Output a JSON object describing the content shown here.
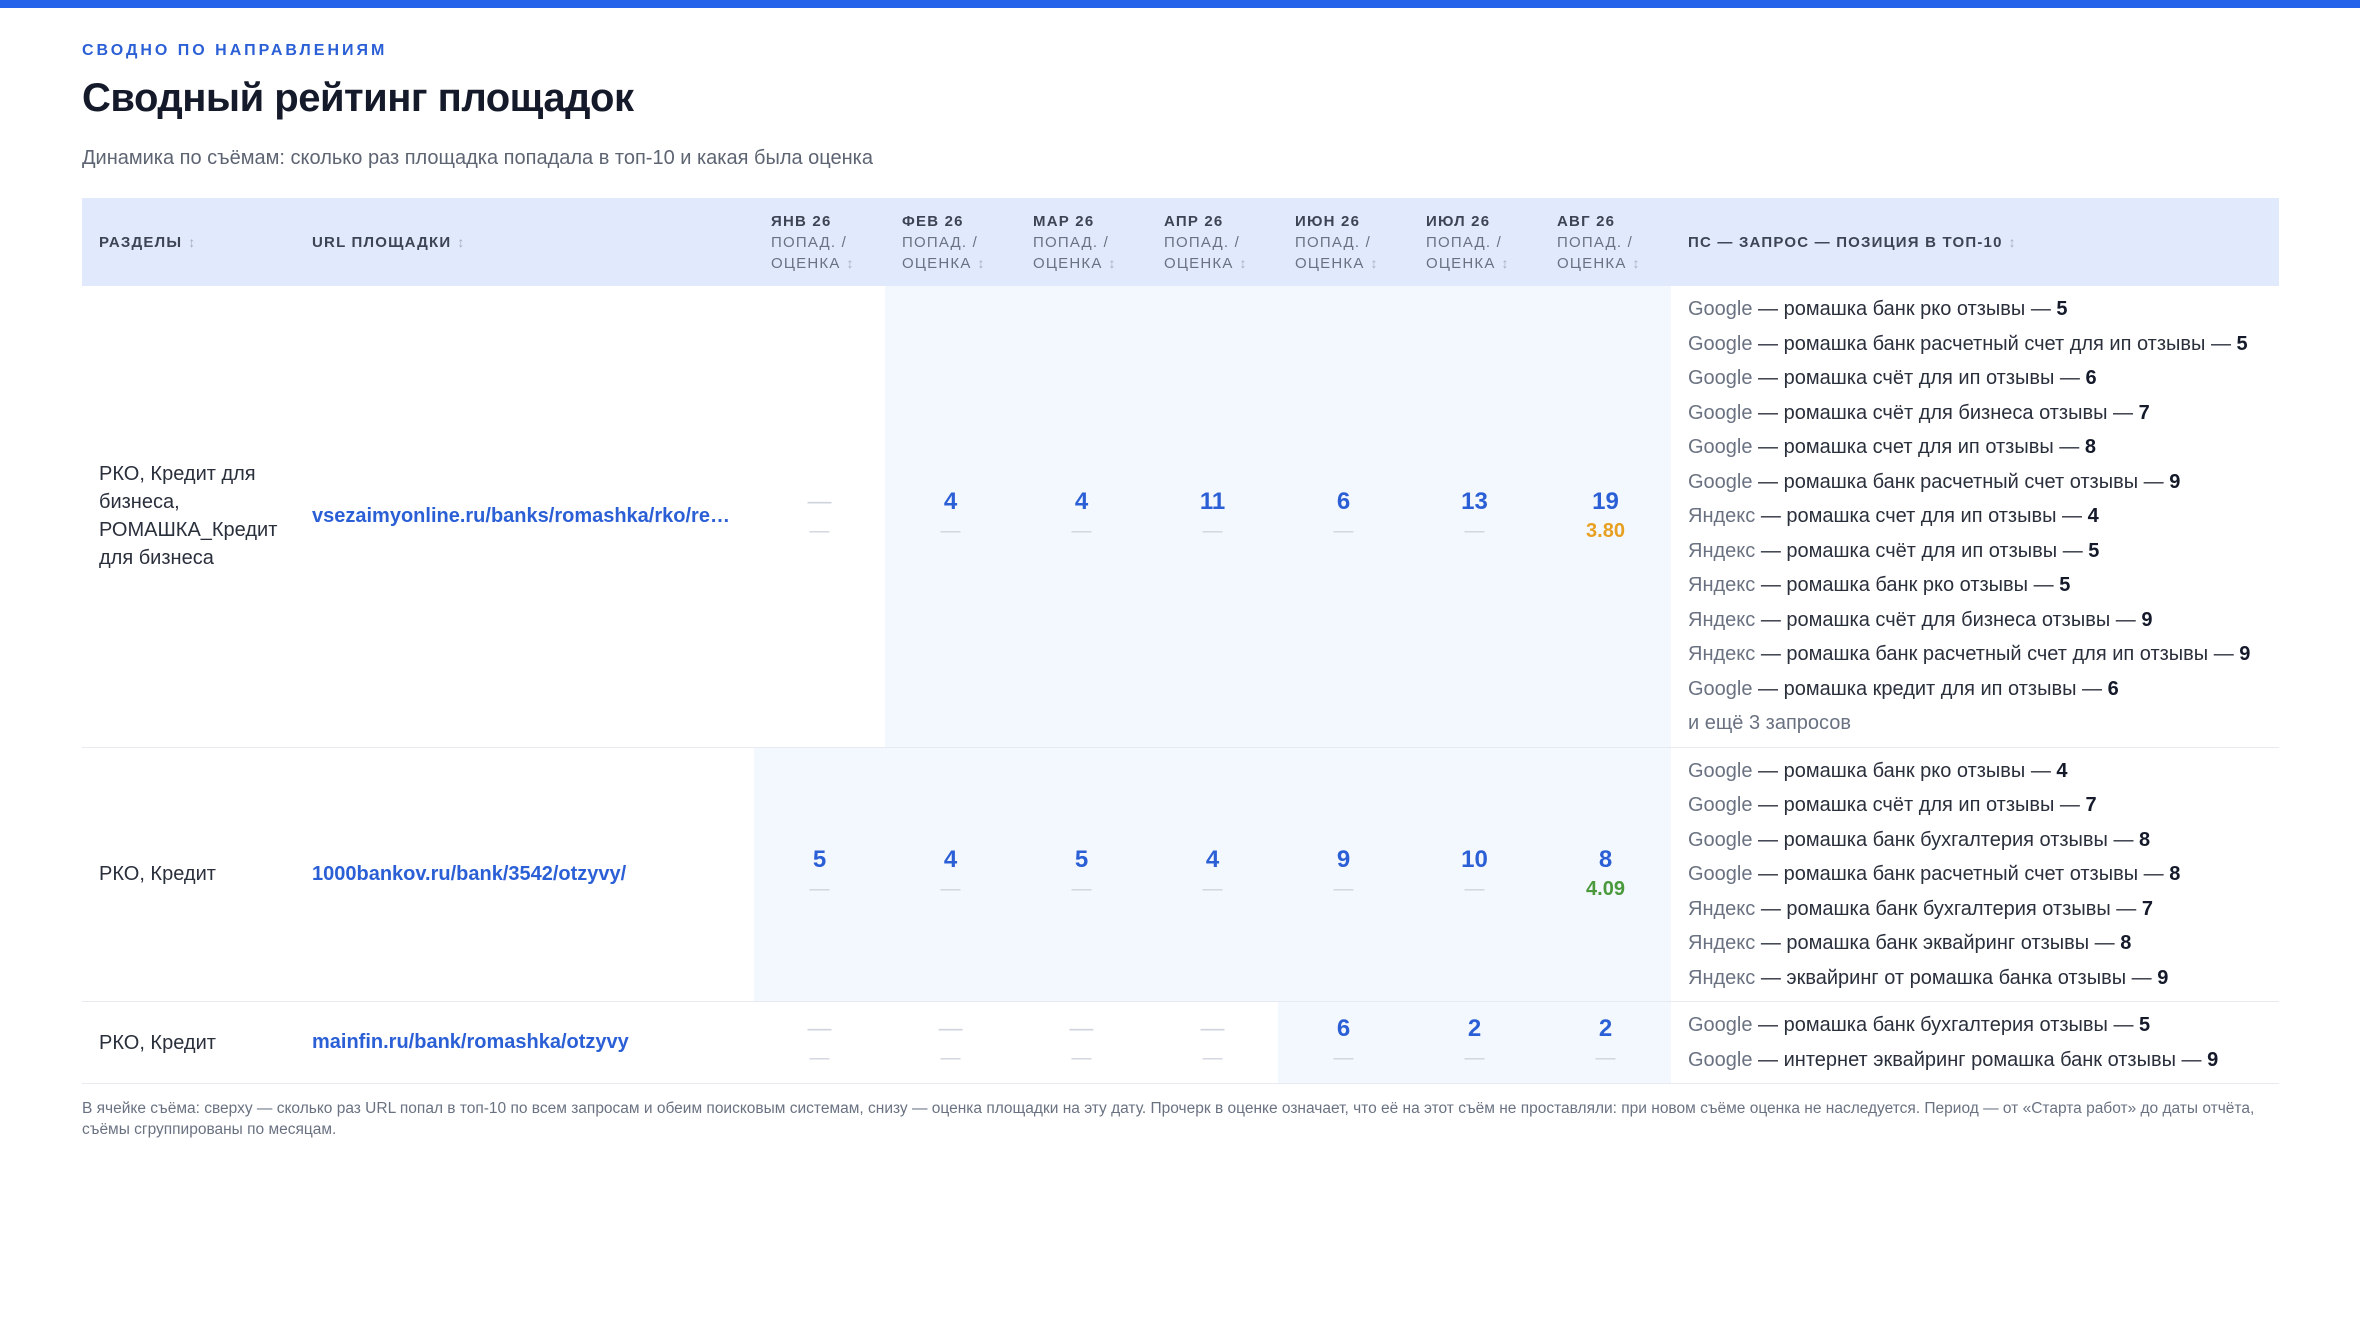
{
  "eyebrow": "СВОДНО ПО НАПРАВЛЕНИЯМ",
  "title": "Сводный рейтинг площадок",
  "subtitle": "Динамика по съёмам: сколько раз площадка попадала в топ-10 и какая была оценка",
  "columns": {
    "sections": "РАЗДЕЛЫ",
    "url": "URL ПЛОЩАДКИ",
    "sub1": "ПОПАД. /",
    "sub2": "ОЦЕНКА",
    "queries": "ПС — ЗАПРОС — ПОЗИЦИЯ В ТОП-10",
    "sort_icon": "↕",
    "months": [
      "ЯНВ 26",
      "ФЕВ 26",
      "МАР 26",
      "АПР 26",
      "ИЮН 26",
      "ИЮЛ 26",
      "АВГ 26"
    ]
  },
  "dash": "—",
  "separator": " — ",
  "rows": [
    {
      "section": "РКО, Кредит для бизнеса, РОМАШКА_Кредит для бизнеса",
      "url": "vsezaimyonline.ru/banks/romashka/rko/reviews/",
      "cells": [
        {
          "count": "—",
          "score": "—"
        },
        {
          "count": "4",
          "score": "—"
        },
        {
          "count": "4",
          "score": "—"
        },
        {
          "count": "11",
          "score": "—"
        },
        {
          "count": "6",
          "score": "—"
        },
        {
          "count": "13",
          "score": "—"
        },
        {
          "count": "19",
          "score": "3.80",
          "score_color": "#e8a020"
        }
      ],
      "queries": [
        {
          "engine": "Google",
          "query": "ромашка банк рко отзывы",
          "pos": "5"
        },
        {
          "engine": "Google",
          "query": "ромашка банк расчетный счет для ип отзывы",
          "pos": "5"
        },
        {
          "engine": "Google",
          "query": "ромашка счёт для ип отзывы",
          "pos": "6"
        },
        {
          "engine": "Google",
          "query": "ромашка счёт для бизнеса отзывы",
          "pos": "7"
        },
        {
          "engine": "Google",
          "query": "ромашка счет для ип отзывы",
          "pos": "8"
        },
        {
          "engine": "Google",
          "query": "ромашка банк расчетный счет отзывы",
          "pos": "9"
        },
        {
          "engine": "Яндекс",
          "query": "ромашка счет для ип отзывы",
          "pos": "4"
        },
        {
          "engine": "Яндекс",
          "query": "ромашка счёт для ип отзывы",
          "pos": "5"
        },
        {
          "engine": "Яндекс",
          "query": "ромашка банк рко отзывы",
          "pos": "5"
        },
        {
          "engine": "Яндекс",
          "query": "ромашка счёт для бизнеса отзывы",
          "pos": "9"
        },
        {
          "engine": "Яндекс",
          "query": "ромашка банк расчетный счет для ип отзывы",
          "pos": "9"
        },
        {
          "engine": "Google",
          "query": "ромашка кредит для ип отзывы",
          "pos": "6"
        }
      ],
      "more": "и ещё 3 запросов"
    },
    {
      "section": "РКО, Кредит",
      "url": "1000bankov.ru/bank/3542/otzyvy/",
      "cells": [
        {
          "count": "5",
          "score": "—"
        },
        {
          "count": "4",
          "score": "—"
        },
        {
          "count": "5",
          "score": "—"
        },
        {
          "count": "4",
          "score": "—"
        },
        {
          "count": "9",
          "score": "—"
        },
        {
          "count": "10",
          "score": "—"
        },
        {
          "count": "8",
          "score": "4.09",
          "score_color": "#4a9a3c"
        }
      ],
      "queries": [
        {
          "engine": "Google",
          "query": "ромашка банк рко отзывы",
          "pos": "4"
        },
        {
          "engine": "Google",
          "query": "ромашка счёт для ип отзывы",
          "pos": "7"
        },
        {
          "engine": "Google",
          "query": "ромашка банк бухгалтерия отзывы",
          "pos": "8"
        },
        {
          "engine": "Google",
          "query": "ромашка банк расчетный счет отзывы",
          "pos": "8"
        },
        {
          "engine": "Яндекс",
          "query": "ромашка банк бухгалтерия отзывы",
          "pos": "7"
        },
        {
          "engine": "Яндекс",
          "query": "ромашка банк эквайринг отзывы",
          "pos": "8"
        },
        {
          "engine": "Яндекс",
          "query": "эквайринг от ромашка банка отзывы",
          "pos": "9"
        }
      ],
      "more": ""
    },
    {
      "section": "РКО, Кредит",
      "url": "mainfin.ru/bank/romashka/otzyvy",
      "cells": [
        {
          "count": "—",
          "score": "—"
        },
        {
          "count": "—",
          "score": "—"
        },
        {
          "count": "—",
          "score": "—"
        },
        {
          "count": "—",
          "score": "—"
        },
        {
          "count": "6",
          "score": "—"
        },
        {
          "count": "2",
          "score": "—"
        },
        {
          "count": "2",
          "score": "—"
        }
      ],
      "queries": [
        {
          "engine": "Google",
          "query": "ромашка банк бухгалтерия отзывы",
          "pos": "5"
        },
        {
          "engine": "Google",
          "query": "интернет эквайринг ромашка банк отзывы",
          "pos": "9"
        }
      ],
      "more": ""
    }
  ],
  "footnote": "В ячейке съёма: сверху — сколько раз URL попал в топ-10 по всем запросам и обеим поисковым системам, снизу — оценка площадки на эту дату. Прочерк в оценке означает, что её на этот съём не проставляли: при новом съёме оценка не наследуется. Период — от «Старта работ» до даты отчёта, съёмы сгруппированы по месяцам.",
  "colors": {
    "accent": "#2563eb",
    "header_bg": "#e1eafc",
    "highlight_bg": "#f3f7fe"
  }
}
